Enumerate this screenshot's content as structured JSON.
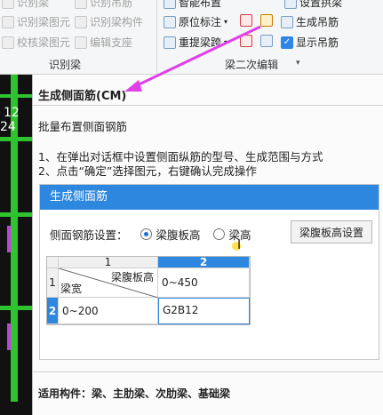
{
  "ribbon": {
    "left_group": {
      "items": [
        "识别梁",
        "识别梁图元",
        "校核梁图元",
        "识别吊筋",
        "识别梁构件",
        "编辑支座"
      ],
      "label": "识别梁"
    },
    "right_group": {
      "items": [
        "智能布置",
        "设置拱梁",
        "原位标注",
        "生成吊筋",
        "重提梁跨",
        "显示吊筋"
      ],
      "label": "梁二次编辑"
    }
  },
  "tooltip": {
    "title": "生成侧面筋(CM)",
    "subtitle": "批量布置侧面钢筋",
    "steps": [
      "1、在弹出对话框中设置侧面纵筋的型号、生成范围与方式",
      "2、点击“确定”选择图元，右键确认完成操作"
    ],
    "applicable": "适用构件：梁、主肋梁、次肋梁、基础梁"
  },
  "dialog": {
    "title": "生成侧面筋",
    "setting_label": "侧面钢筋设置：",
    "radio_web": "梁腹板高",
    "radio_beam": "梁高",
    "button": "梁腹板高设置",
    "table": {
      "col_headers": [
        "1",
        "2"
      ],
      "row_headers": [
        "1",
        "2"
      ],
      "corner_top": "梁腹板高",
      "corner_bottom": "梁宽",
      "r1c2": "0~450",
      "r2c1": "0~200",
      "r2c2": "G2B12"
    }
  },
  "cad": {
    "labels": [
      "12",
      "24"
    ]
  },
  "colors": {
    "accent": "#2e87de",
    "arrow": "#e040e8"
  }
}
